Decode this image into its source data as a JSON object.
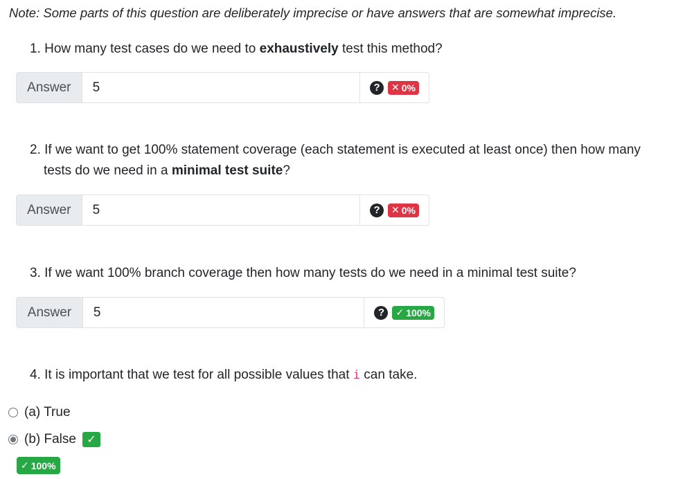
{
  "note": "Note: Some parts of this question are deliberately imprecise or have answers that are somewhat imprecise.",
  "q1": {
    "prefix": "1. How many test cases do we need to ",
    "bold": "exhaustively",
    "suffix": " test this method?",
    "answer_label": "Answer",
    "answer_value": "5",
    "score": "0%"
  },
  "q2": {
    "line1": "2. If we want to get 100% statement coverage (each statement is executed at least once) then how many",
    "line2_prefix": "tests do we need in a ",
    "bold": "minimal test suite",
    "suffix": "?",
    "answer_label": "Answer",
    "answer_value": "5",
    "score": "0%"
  },
  "q3": {
    "text": "3. If we want 100% branch coverage then how many tests do we need in a minimal test suite?",
    "answer_label": "Answer",
    "answer_value": "5",
    "score": "100%"
  },
  "q4": {
    "prefix": "4. It is important that we test for all possible values that ",
    "code": "i",
    "suffix": " can take.",
    "option_a": "(a) True",
    "option_b": "(b) False",
    "selected": "b",
    "score": "100%"
  },
  "icons": {
    "help": "question-circle-icon",
    "wrong": "x-mark-icon",
    "right": "check-mark-icon"
  },
  "colors": {
    "wrong": "#dc3545",
    "right": "#28a745",
    "code": "#d63384"
  }
}
